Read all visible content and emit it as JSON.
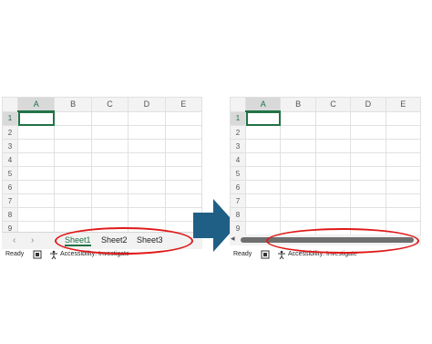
{
  "left": {
    "columns": [
      "A",
      "B",
      "C",
      "D",
      "E"
    ],
    "rows": [
      "1",
      "2",
      "3",
      "4",
      "5",
      "6",
      "7",
      "8",
      "9"
    ],
    "tabs": {
      "prev": "‹",
      "next": "›",
      "sheets": [
        "Sheet1",
        "Sheet2",
        "Sheet3"
      ]
    },
    "status": {
      "ready": "Ready",
      "accessibility": "Accessibility: Investigate"
    }
  },
  "right": {
    "columns": [
      "A",
      "B",
      "C",
      "D",
      "E"
    ],
    "rows": [
      "1",
      "2",
      "3",
      "4",
      "5",
      "6",
      "7",
      "8",
      "9"
    ],
    "scroll_left": "◂",
    "status": {
      "ready": "Ready",
      "accessibility": "Accessibility: Investigate"
    }
  },
  "colors": {
    "accent": "#217346",
    "highlight": "#e01919",
    "arrow": "#1f5f86"
  },
  "icons": [
    "accessibility-icon",
    "macro-icon",
    "arrow-right-icon"
  ]
}
